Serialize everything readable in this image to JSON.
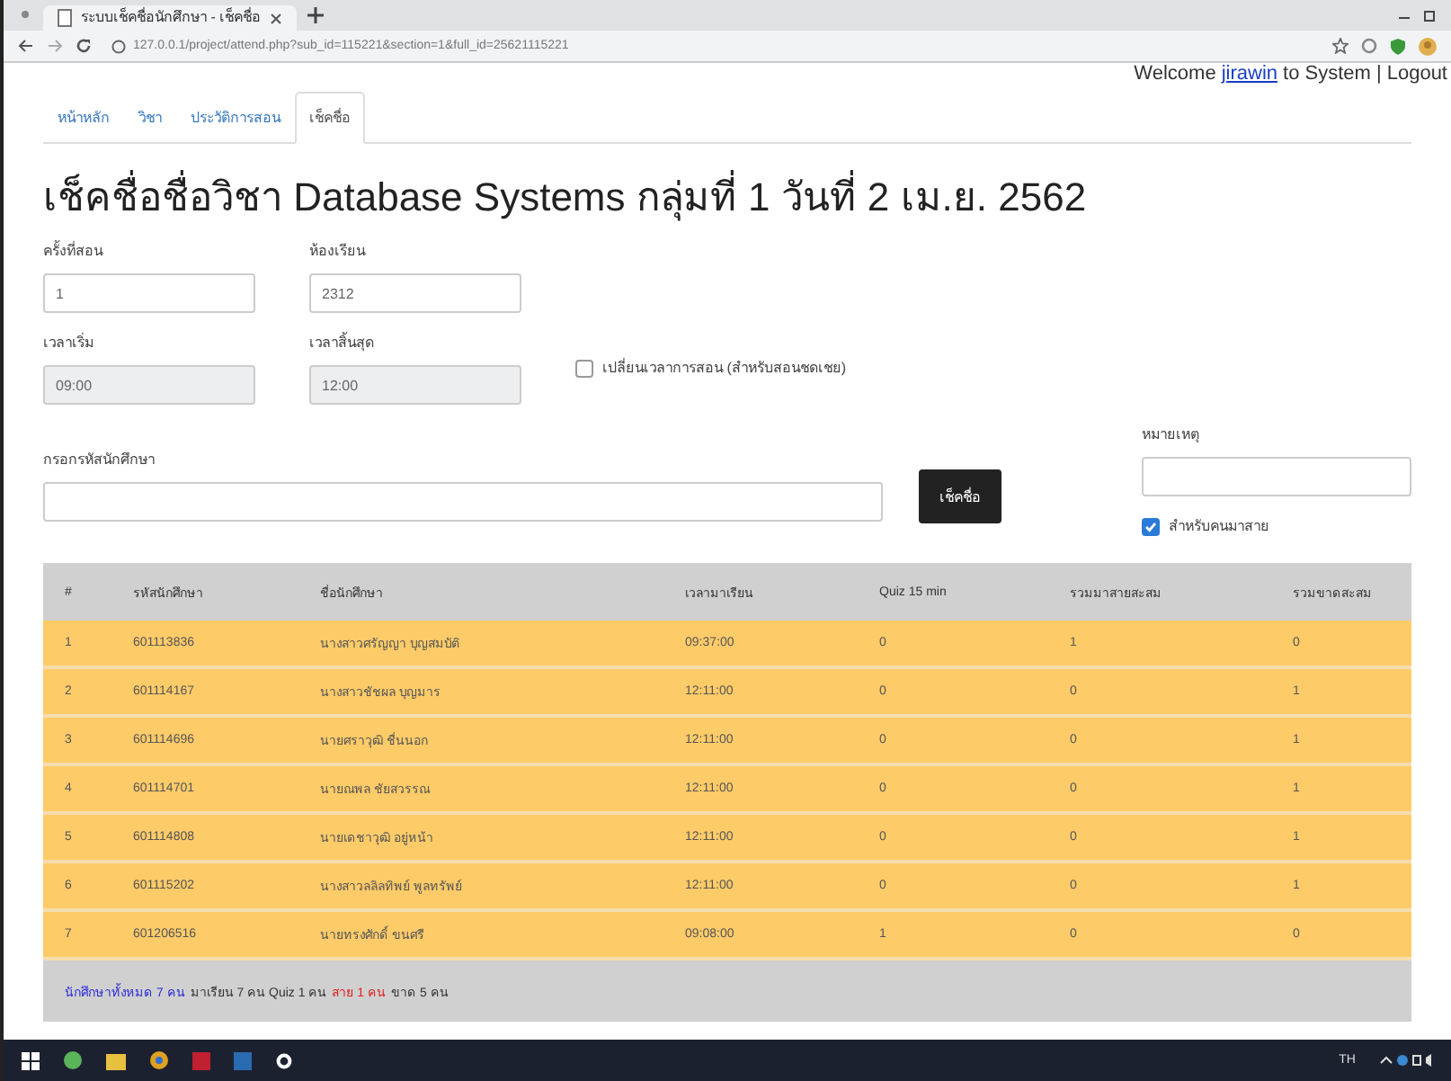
{
  "browser": {
    "tab_title": "ระบบเช็คชื่อนักศึกษา - เช็คชื่อ",
    "url": "127.0.0.1/project/attend.php?sub_id=115221&section=1&full_id=25621115221"
  },
  "welcome": {
    "before": "Welcome",
    "user": "jirawin",
    "after": "to System |",
    "logout": "Logout"
  },
  "tabs": [
    {
      "label": "หน้าหลัก",
      "selected": false
    },
    {
      "label": "วิชา",
      "selected": false
    },
    {
      "label": "ประวัติการสอน",
      "selected": false
    },
    {
      "label": "เช็คชื่อ",
      "selected": true
    }
  ],
  "heading": "เช็คชื่อชื่อวิชา Database Systems กลุ่มที่ 1 วันที่ 2 เม.ย. 2562",
  "fields_row1": [
    {
      "label": "ครั้งที่สอน",
      "value": "1",
      "disabled": false
    },
    {
      "label": "ห้องเรียน",
      "value": "2312",
      "disabled": false
    }
  ],
  "fields_row2": [
    {
      "label": "เวลาเริ่ม",
      "value": "09:00",
      "disabled": true
    },
    {
      "label": "เวลาสิ้นสุด",
      "value": "12:00",
      "disabled": true
    }
  ],
  "change_time": {
    "label": "เปลี่ยนเวลาการสอน (สำหรับสอนชดเชย)",
    "checked": false
  },
  "student_id": {
    "label": "กรอกรหัสนักศึกษา"
  },
  "check_button": "เช็คชื่อ",
  "note": {
    "label": "หมายเหตุ"
  },
  "late": {
    "label": "สำหรับคนมาสาย",
    "checked": true
  },
  "table": {
    "columns": [
      "#",
      "รหัสนักศึกษา",
      "ชื่อนักศึกษา",
      "เวลามาเรียน",
      "Quiz 15 min",
      "รวมมาสายสะสม",
      "รวมขาดสะสม"
    ],
    "rows": [
      [
        "1",
        "601113836",
        "นางสาวศรัญญา บุญสมบัติ",
        "09:37:00",
        "0",
        "1",
        "0"
      ],
      [
        "2",
        "601114167",
        "นางสาวชัชผล บุญมาร",
        "12:11:00",
        "0",
        "0",
        "1"
      ],
      [
        "3",
        "601114696",
        "นายศราวุฒิ ชื่นนอก",
        "12:11:00",
        "0",
        "0",
        "1"
      ],
      [
        "4",
        "601114701",
        "นายณพล ชัยสวรรณ",
        "12:11:00",
        "0",
        "0",
        "1"
      ],
      [
        "5",
        "601114808",
        "นายเดชาวุฒิ อยู่หน้า",
        "12:11:00",
        "0",
        "0",
        "1"
      ],
      [
        "6",
        "601115202",
        "นางสาวลลิลทิพย์ พูลทรัพย์",
        "12:11:00",
        "0",
        "0",
        "1"
      ],
      [
        "7",
        "601206516",
        "นายทรงศักดิ์ ขนศรี",
        "09:08:00",
        "1",
        "0",
        "0"
      ]
    ],
    "summary": [
      {
        "text": "นักศึกษาทั้งหมด 7 คน",
        "color": "#2b2bd8"
      },
      {
        "text": "มาเรียน 7 คน Quiz 1 คน",
        "color": "#333333"
      },
      {
        "text": "สาย 1 คน",
        "color": "#e02020"
      },
      {
        "text": "ขาด 5 คน",
        "color": "#333333"
      }
    ]
  },
  "taskbar": {
    "language": "TH"
  }
}
